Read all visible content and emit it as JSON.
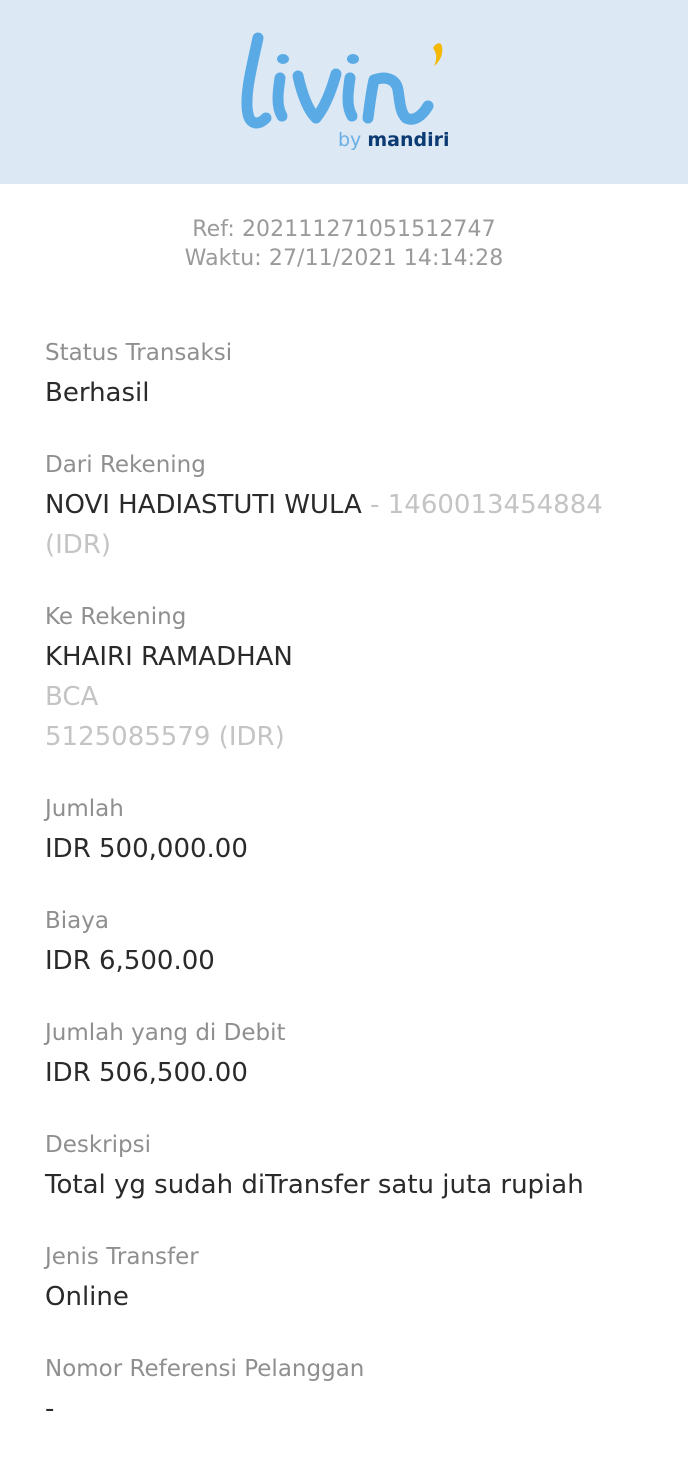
{
  "header": {
    "logo_text": "livin'",
    "by_text": "by",
    "brand_text": "mandiri",
    "colors": {
      "background": "#dce8f4",
      "logo_blue": "#5aaae6",
      "logo_accent": "#f5b800",
      "brand_navy": "#0c3b73"
    }
  },
  "receipt": {
    "ref": "Ref: 20211127105151 2747",
    "ref_clean": "Ref: 202111271051512747",
    "waktu": "Waktu: 27/11/2021 14:14:28"
  },
  "fields": {
    "status": {
      "label": "Status Transaksi",
      "value": "Berhasil"
    },
    "dari": {
      "label": "Dari Rekening",
      "name": "NOVI HADIASTUTI WULA",
      "account": " - 1460013454884 (IDR)"
    },
    "ke": {
      "label": "Ke Rekening",
      "name": "KHAIRI RAMADHAN",
      "bank": "BCA",
      "account": "5125085579 (IDR)"
    },
    "jumlah": {
      "label": "Jumlah",
      "value": "IDR 500,000.00"
    },
    "biaya": {
      "label": "Biaya",
      "value": "IDR 6,500.00"
    },
    "debit": {
      "label": "Jumlah yang di Debit",
      "value": "IDR 506,500.00"
    },
    "deskripsi": {
      "label": "Deskripsi",
      "value": "Total yg sudah diTransfer satu juta rupiah"
    },
    "jenis": {
      "label": "Jenis Transfer",
      "value": "Online"
    },
    "nomor_ref": {
      "label": "Nomor Referensi Pelanggan",
      "value": "-"
    }
  }
}
